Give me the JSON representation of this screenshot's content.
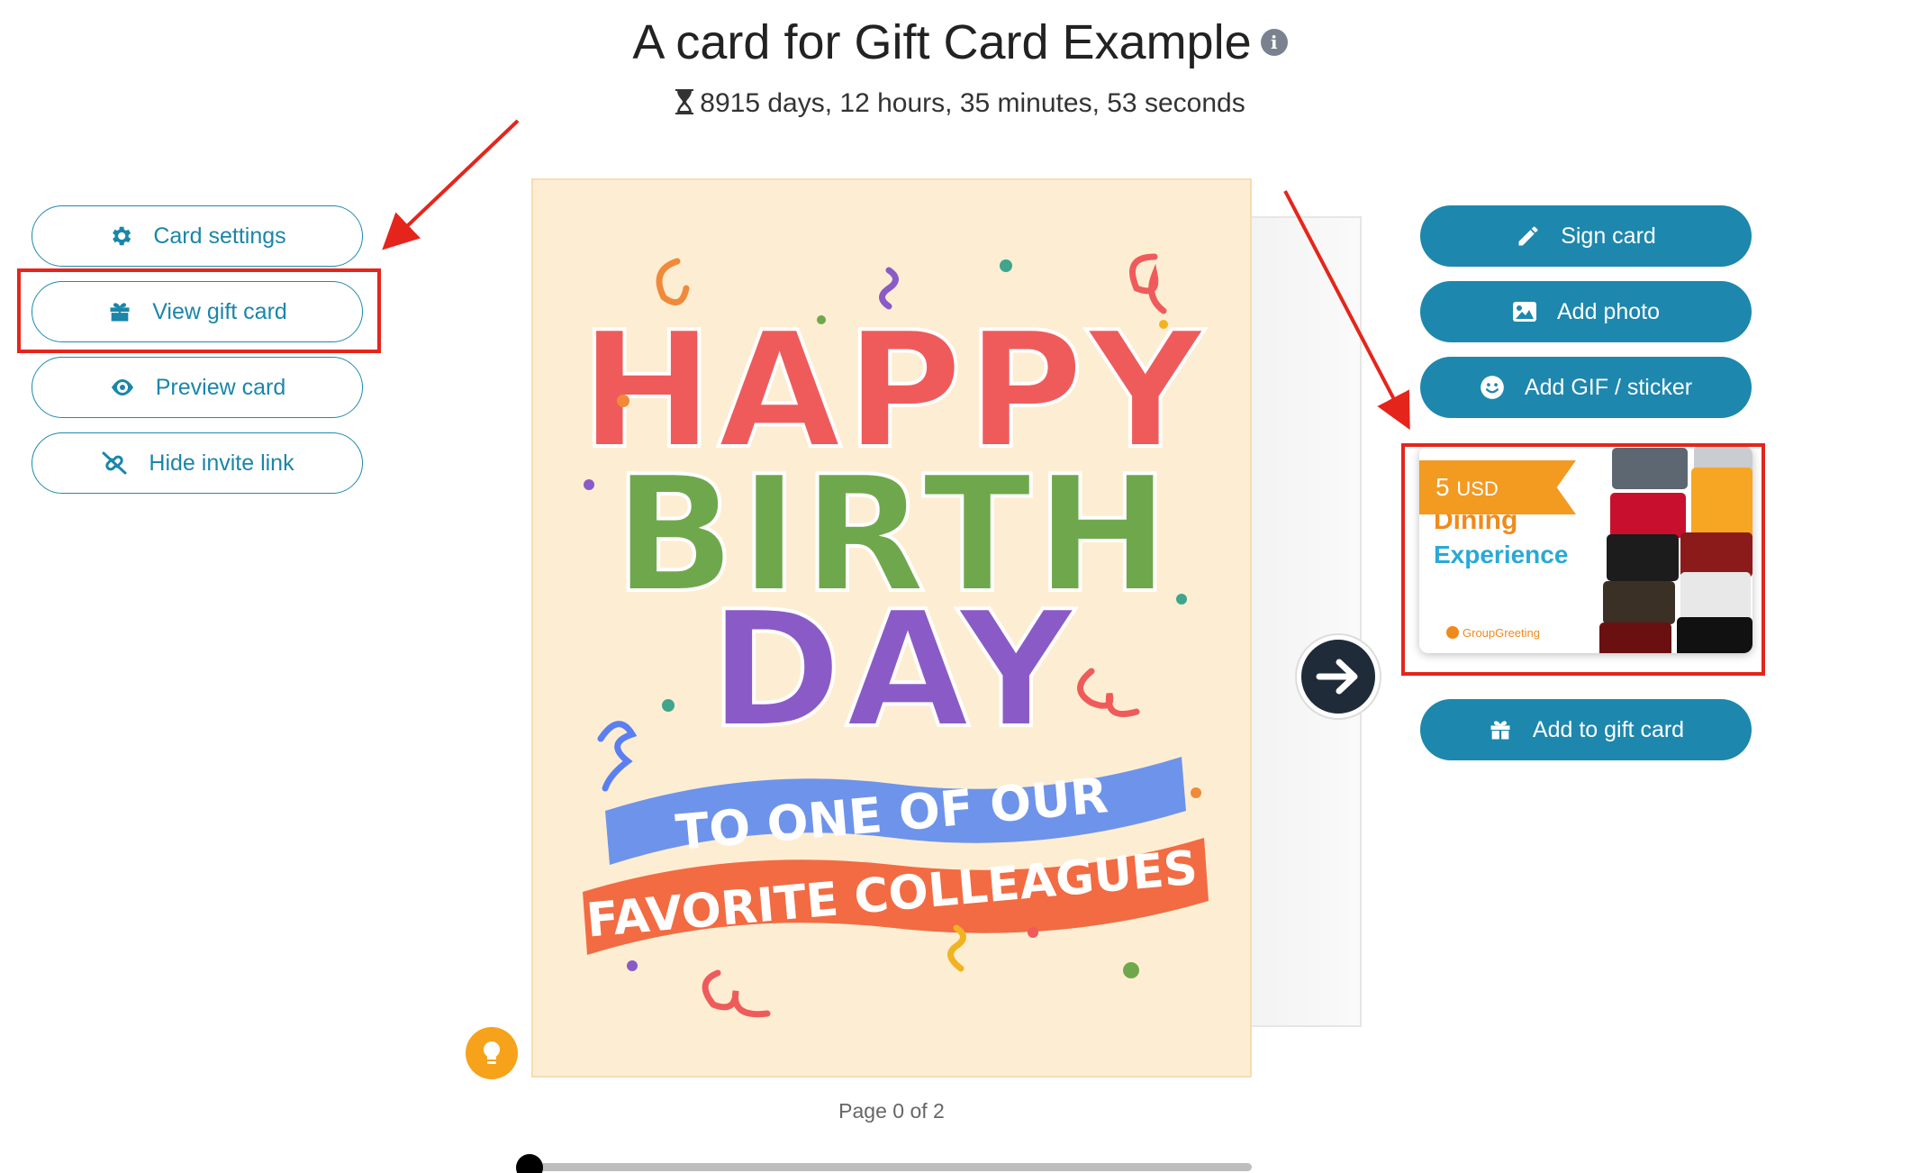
{
  "header": {
    "title": "A card for Gift Card Example",
    "info_icon": "i",
    "timer_icon": "hourglass-icon",
    "countdown": "8915 days, 12 hours, 35 minutes, 53 seconds"
  },
  "left_menu": {
    "items": [
      {
        "label": "Card settings",
        "icon": "gear-icon"
      },
      {
        "label": "View gift card",
        "icon": "gift-icon"
      },
      {
        "label": "Preview card",
        "icon": "eye-icon"
      },
      {
        "label": "Hide invite link",
        "icon": "link-slash-icon"
      }
    ]
  },
  "right_menu": {
    "sign_card": "Sign card",
    "add_photo": "Add photo",
    "add_gif": "Add GIF / sticker",
    "add_gift": "Add to gift card"
  },
  "gift_card": {
    "amount": "5",
    "currency": "USD",
    "line1": "Dining",
    "line2": "Experience",
    "brand": "GroupGreeting"
  },
  "card": {
    "lines": [
      "HAPPY",
      "BIRTH",
      "DAY"
    ],
    "banner1": "TO ONE OF OUR",
    "banner2": "FAVORITE COLLEAGUES"
  },
  "pager": {
    "label": "Page 0 of 2",
    "progress": 0
  },
  "colors": {
    "accent": "#1e87ad",
    "highlight": "#e5251b",
    "ribbon": "#f39a21",
    "card_bg": "#fdeed3"
  }
}
